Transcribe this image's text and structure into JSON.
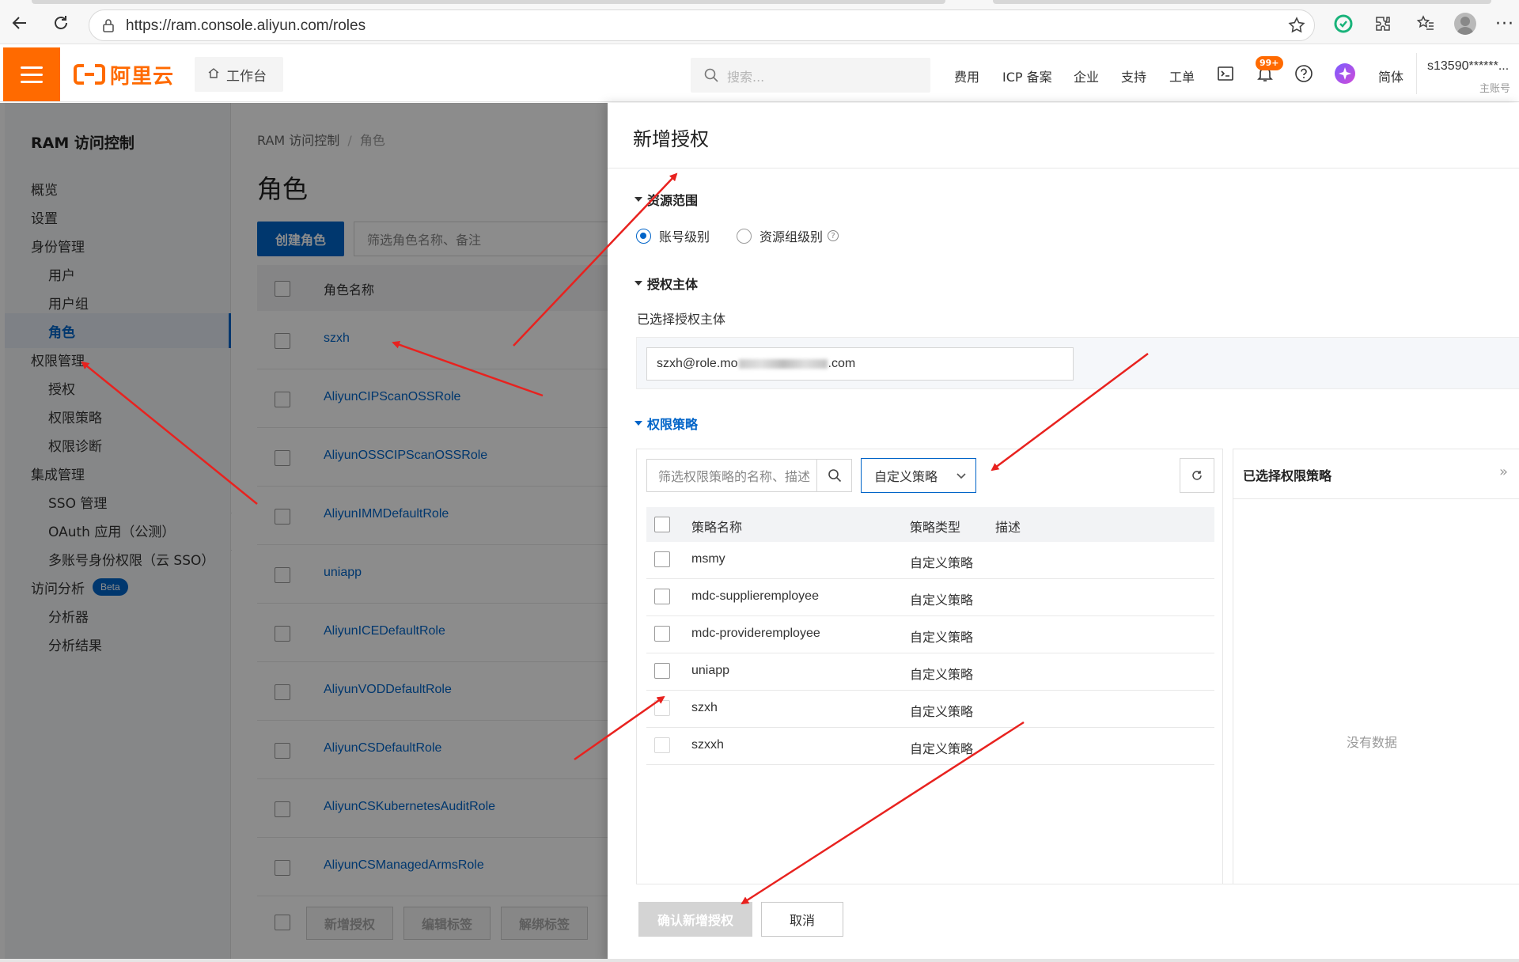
{
  "browser": {
    "url": "https://ram.console.aliyun.com/roles",
    "menu_glyph": "···"
  },
  "header": {
    "logo_text": "阿里云",
    "workbench_label": "工作台",
    "search_placeholder": "搜索...",
    "nav": [
      "费用",
      "ICP 备案",
      "企业",
      "支持",
      "工单"
    ],
    "notification_badge": "99+",
    "language": "简体",
    "account_name": "s13590******...",
    "account_role": "主账号",
    "brand_color": "#ff6a00"
  },
  "sidebar": {
    "title": "RAM 访问控制",
    "items": [
      {
        "label": "概览",
        "level": 1
      },
      {
        "label": "设置",
        "level": 1
      },
      {
        "label": "身份管理",
        "level": 1
      },
      {
        "label": "用户",
        "level": 2
      },
      {
        "label": "用户组",
        "level": 2
      },
      {
        "label": "角色",
        "level": 2,
        "active": true
      },
      {
        "label": "权限管理",
        "level": 1
      },
      {
        "label": "授权",
        "level": 2
      },
      {
        "label": "权限策略",
        "level": 2
      },
      {
        "label": "权限诊断",
        "level": 2
      },
      {
        "label": "集成管理",
        "level": 1
      },
      {
        "label": "SSO 管理",
        "level": 2
      },
      {
        "label": "OAuth 应用（公测）",
        "level": 2
      },
      {
        "label": "多账号身份权限（云 SSO）",
        "level": 2
      },
      {
        "label": "访问分析",
        "level": 1,
        "badge": "Beta"
      },
      {
        "label": "分析器",
        "level": 2
      },
      {
        "label": "分析结果",
        "level": 2
      }
    ]
  },
  "roles_page": {
    "breadcrumb": [
      "RAM 访问控制",
      "角色"
    ],
    "breadcrumb_separator": "/",
    "title": "角色",
    "create_button": "创建角色",
    "filter_placeholder": "筛选角色名称、备注",
    "column_name": "角色名称",
    "roles": [
      "szxh",
      "AliyunCIPScanOSSRole",
      "AliyunOSSCIPScanOSSRole",
      "AliyunIMMDefaultRole",
      "uniapp",
      "AliyunICEDefaultRole",
      "AliyunVODDefaultRole",
      "AliyunCSDefaultRole",
      "AliyunCSKubernetesAuditRole",
      "AliyunCSManagedArmsRole"
    ],
    "bulk_actions": [
      "新增授权",
      "编辑标签",
      "解绑标签"
    ]
  },
  "drawer": {
    "title": "新增授权",
    "resource_scope": {
      "heading": "资源范围",
      "options": [
        {
          "label": "账号级别",
          "selected": true
        },
        {
          "label": "资源组级别",
          "selected": false
        }
      ]
    },
    "principal": {
      "heading": "授权主体",
      "selected_label": "已选择授权主体",
      "value_prefix": "szxh@role.mo",
      "value_suffix": ".com"
    },
    "policy": {
      "heading": "权限策略",
      "search_placeholder": "筛选权限策略的名称、描述",
      "type_select_value": "自定义策略",
      "columns": [
        "策略名称",
        "策略类型",
        "描述"
      ],
      "rows": [
        {
          "name": "msmy",
          "type": "自定义策略"
        },
        {
          "name": "mdc-supplieremployee",
          "type": "自定义策略"
        },
        {
          "name": "mdc-provideremployee",
          "type": "自定义策略"
        },
        {
          "name": "uniapp",
          "type": "自定义策略"
        },
        {
          "name": "szxh",
          "type": "自定义策略"
        },
        {
          "name": "szxxh",
          "type": "自定义策略"
        }
      ]
    },
    "selected_policies": {
      "title": "已选择权限策略",
      "empty_text": "没有数据"
    },
    "confirm_button": "确认新增授权",
    "cancel_button": "取消"
  },
  "colors": {
    "primary": "#0064c8",
    "brand": "#ff6a00",
    "annotation_arrow": "#e8221f"
  }
}
